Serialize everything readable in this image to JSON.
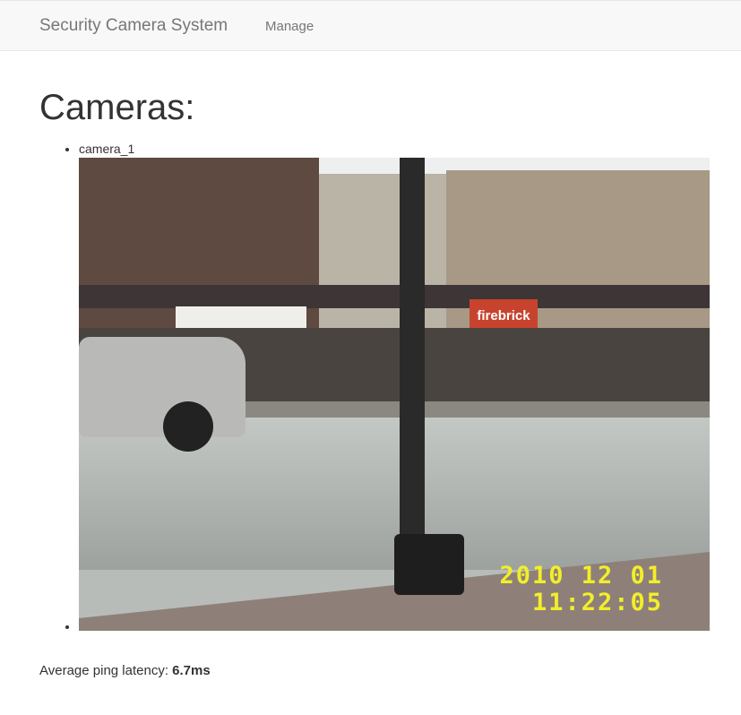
{
  "navbar": {
    "brand": "Security Camera System",
    "links": [
      {
        "label": "Manage"
      }
    ]
  },
  "page": {
    "title": "Cameras:"
  },
  "cameras": [
    {
      "name": "camera_1",
      "overlay": {
        "date": "2010 12 01",
        "time": "11:22:05"
      },
      "signs": {
        "store": "firebrick"
      }
    }
  ],
  "latency": {
    "label": "Average ping latency:",
    "value": "6.7ms"
  }
}
